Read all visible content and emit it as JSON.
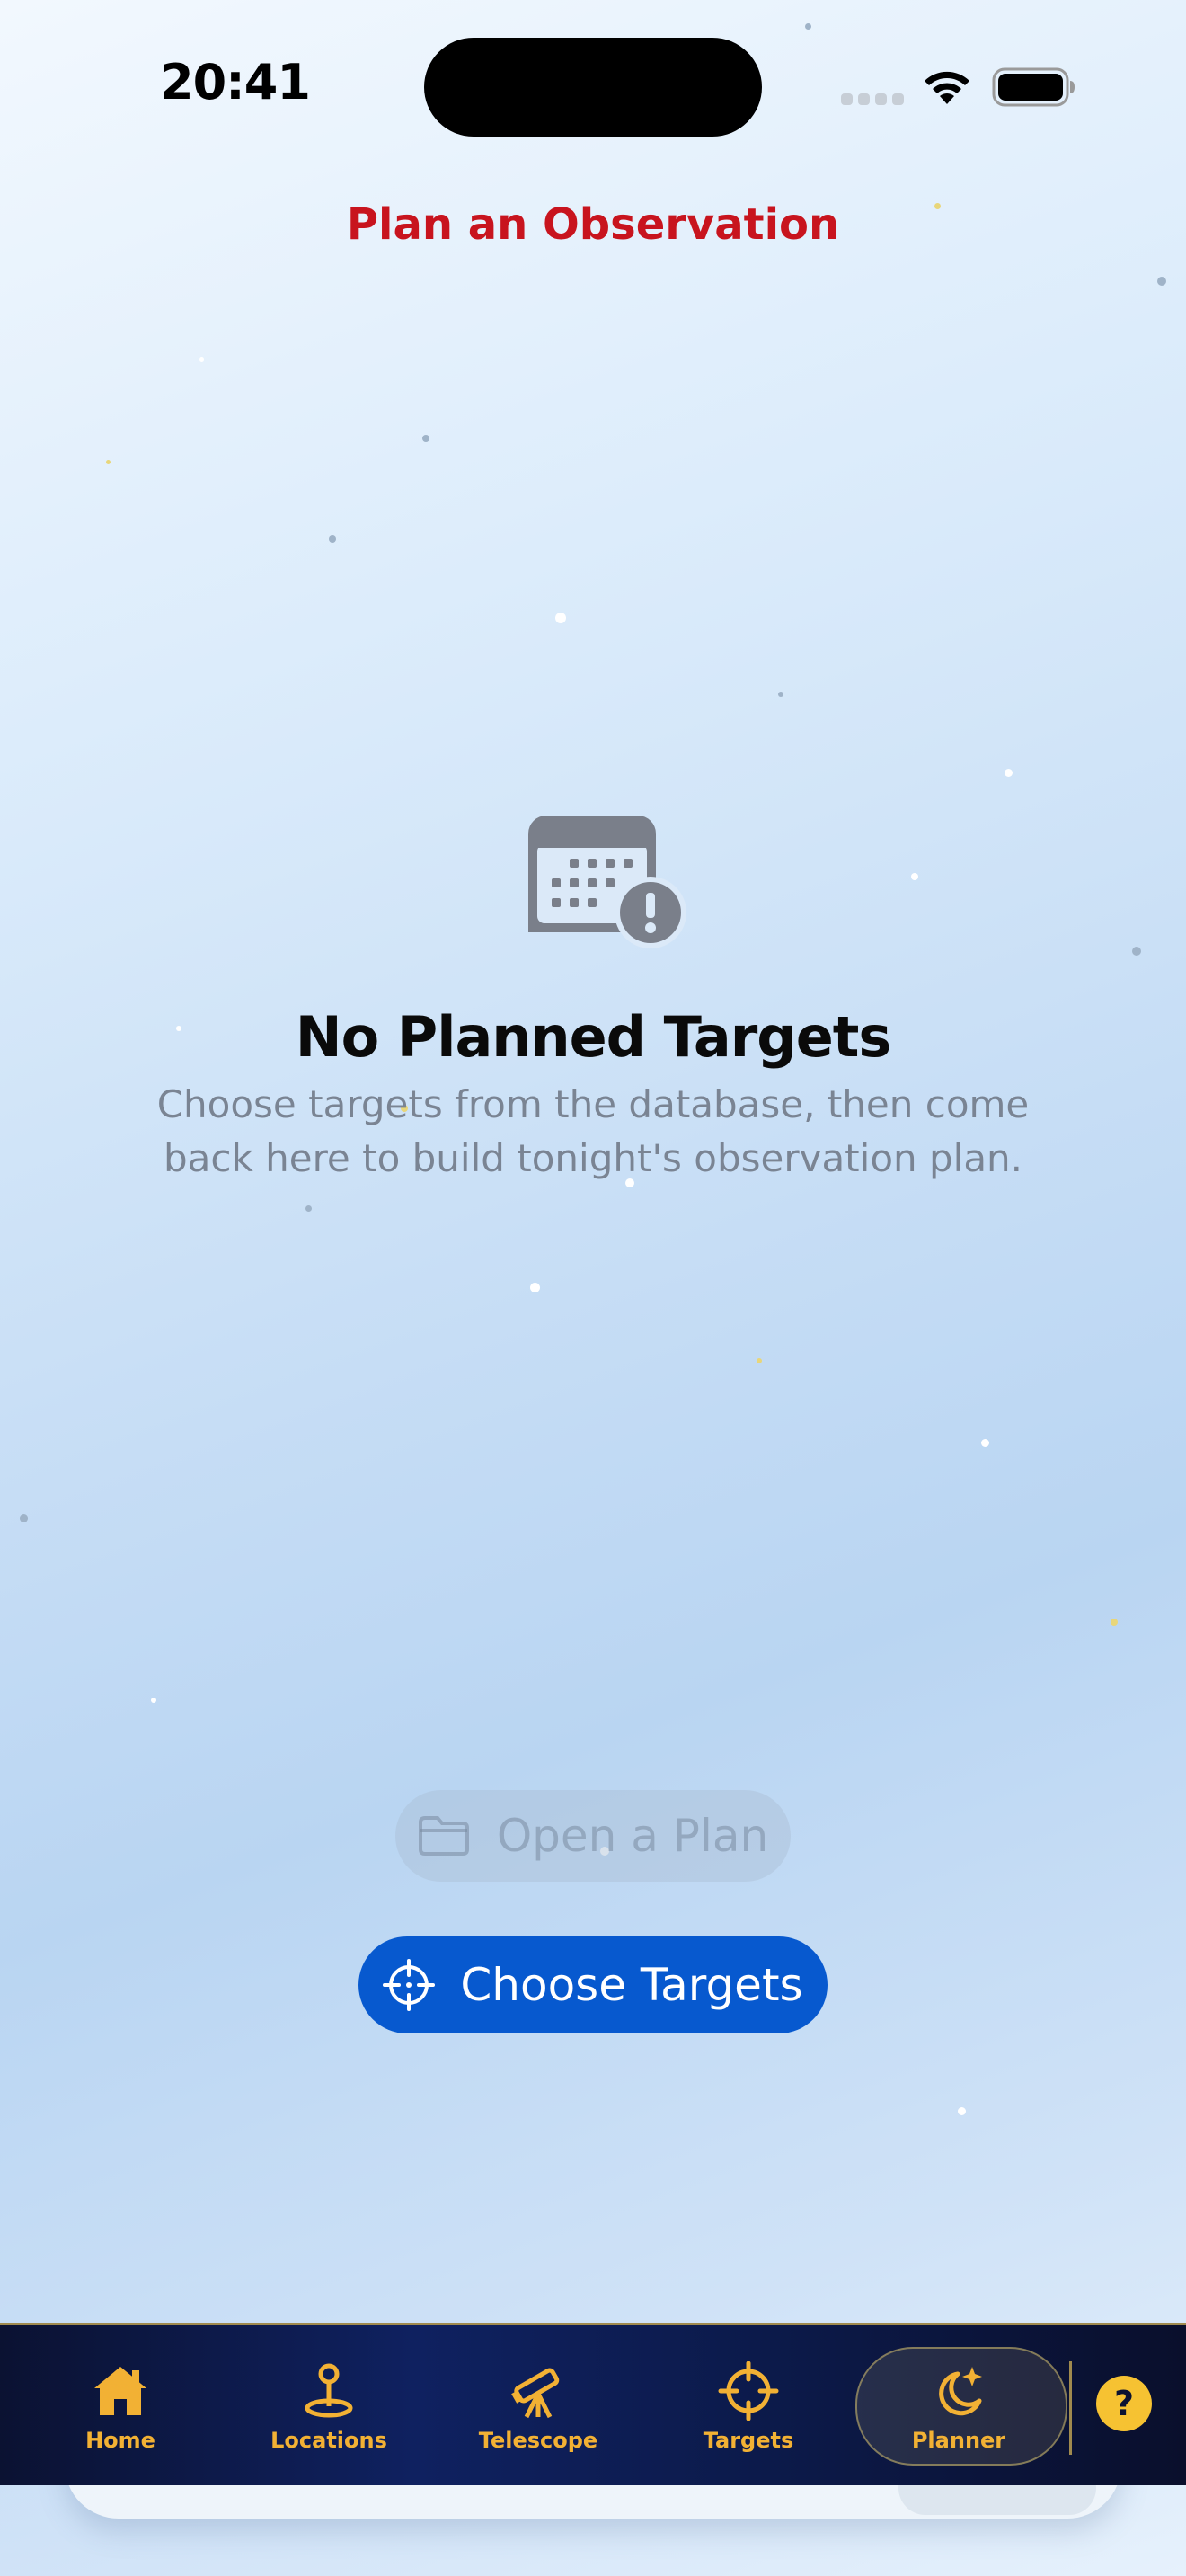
{
  "status_bar": {
    "time": "20:41",
    "icons": [
      "signal-dots-icon",
      "wifi-icon",
      "battery-icon"
    ]
  },
  "nav": {
    "title": "Plan an Observation"
  },
  "empty_state": {
    "icon": "calendar-exclamation-icon",
    "title": "No Planned Targets",
    "description": "Choose targets from the database, then come back here to build tonight's observation plan."
  },
  "actions": {
    "open_plan": {
      "label": "Open a Plan",
      "icon": "folder-icon",
      "enabled": false
    },
    "choose_targets": {
      "label": "Choose Targets",
      "icon": "crosshair-icon"
    }
  },
  "tab_bar": {
    "items": [
      {
        "label": "Home",
        "icon": "house-icon",
        "selected": false
      },
      {
        "label": "Locations",
        "icon": "location-pin-icon",
        "selected": false
      },
      {
        "label": "Telescope",
        "icon": "telescope-icon",
        "selected": false
      },
      {
        "label": "Targets",
        "icon": "crosshair-icon",
        "selected": false
      },
      {
        "label": "Planner",
        "icon": "moon-stars-icon",
        "selected": true
      }
    ],
    "help_label": "?"
  },
  "colors": {
    "title_red": "#c8141e",
    "primary_blue": "#0759cf",
    "tab_gold": "#f2b134",
    "tab_background": "#0f2160"
  }
}
